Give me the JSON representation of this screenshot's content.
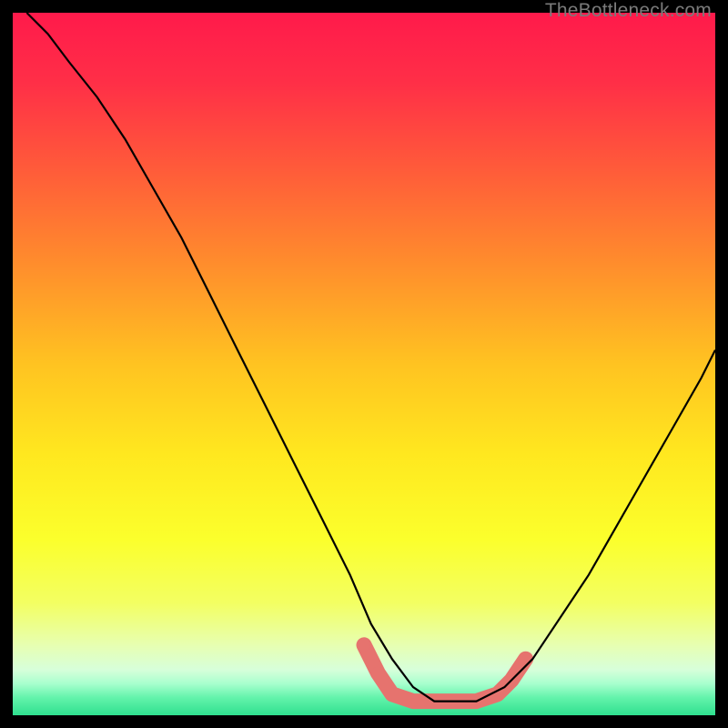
{
  "watermark": "TheBottleneck.com",
  "chart_data": {
    "type": "line",
    "title": "",
    "xlabel": "",
    "ylabel": "",
    "xlim": [
      0,
      100
    ],
    "ylim": [
      0,
      100
    ],
    "grid": false,
    "legend": false,
    "background_gradient_stops": [
      {
        "offset": 0.0,
        "color": "#ff1a4b"
      },
      {
        "offset": 0.1,
        "color": "#ff2f47"
      },
      {
        "offset": 0.22,
        "color": "#ff5a3a"
      },
      {
        "offset": 0.35,
        "color": "#ff8a2d"
      },
      {
        "offset": 0.5,
        "color": "#ffc321"
      },
      {
        "offset": 0.63,
        "color": "#ffe81f"
      },
      {
        "offset": 0.75,
        "color": "#fbff2c"
      },
      {
        "offset": 0.84,
        "color": "#f3ff62"
      },
      {
        "offset": 0.9,
        "color": "#e7ffb1"
      },
      {
        "offset": 0.935,
        "color": "#d7ffda"
      },
      {
        "offset": 0.955,
        "color": "#a8ffce"
      },
      {
        "offset": 0.975,
        "color": "#63f3ab"
      },
      {
        "offset": 1.0,
        "color": "#2fe08f"
      }
    ],
    "series": [
      {
        "name": "bottleneck-curve",
        "color": "#000000",
        "x": [
          2,
          5,
          8,
          12,
          16,
          20,
          24,
          28,
          32,
          36,
          40,
          44,
          48,
          51,
          54,
          57,
          60,
          63,
          66,
          70,
          74,
          78,
          82,
          86,
          90,
          94,
          98,
          100
        ],
        "y": [
          100,
          97,
          93,
          88,
          82,
          75,
          68,
          60,
          52,
          44,
          36,
          28,
          20,
          13,
          8,
          4,
          2,
          2,
          2,
          4,
          8,
          14,
          20,
          27,
          34,
          41,
          48,
          52
        ]
      }
    ],
    "highlight_segment": {
      "name": "optimal-range",
      "color": "#e6736e",
      "points": [
        {
          "x": 50,
          "y": 10,
          "r": 7
        },
        {
          "x": 52,
          "y": 6,
          "r": 7
        },
        {
          "x": 54,
          "y": 3,
          "r": 9
        },
        {
          "x": 57,
          "y": 2,
          "r": 9
        },
        {
          "x": 60,
          "y": 2,
          "r": 9
        },
        {
          "x": 63,
          "y": 2,
          "r": 9
        },
        {
          "x": 66,
          "y": 2,
          "r": 9
        },
        {
          "x": 69,
          "y": 3,
          "r": 9
        },
        {
          "x": 71,
          "y": 5,
          "r": 8
        },
        {
          "x": 73,
          "y": 8,
          "r": 7
        }
      ]
    }
  }
}
